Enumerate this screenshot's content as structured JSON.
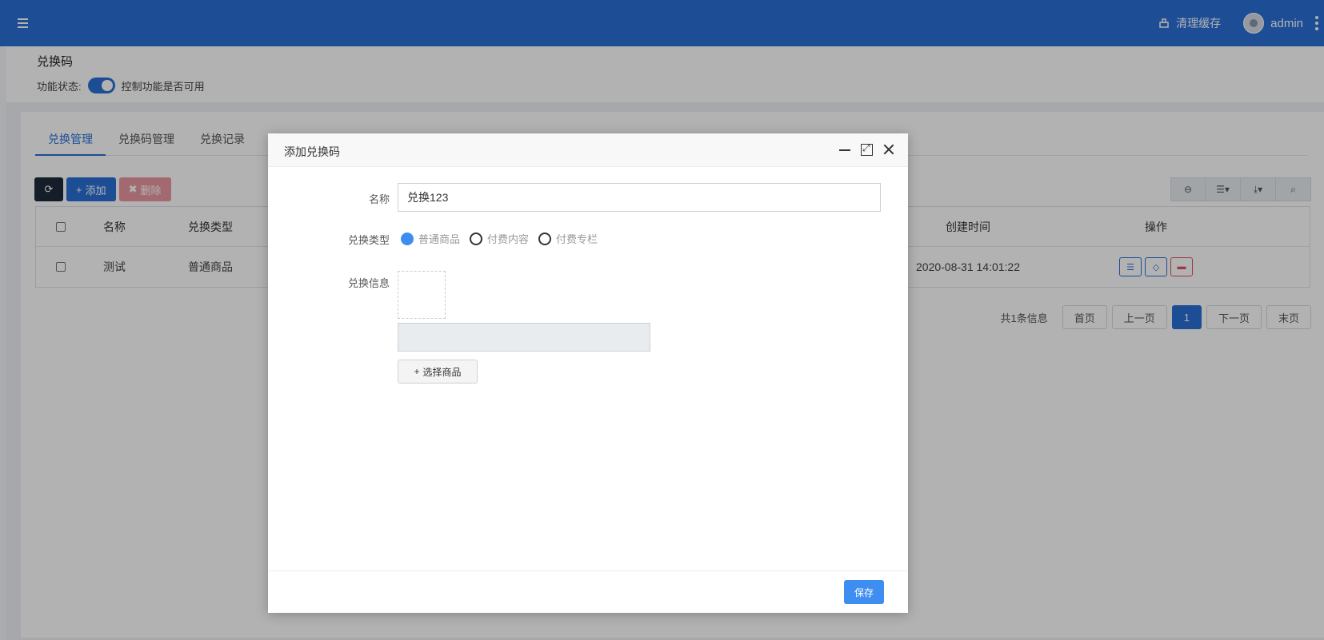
{
  "header": {
    "clear_cache": "清理缓存",
    "user_name": "admin"
  },
  "status_panel": {
    "title": "兑换码",
    "status_label": "功能状态:",
    "status_desc": "控制功能是否可用"
  },
  "tabs": [
    {
      "label": "兑换管理",
      "active": true
    },
    {
      "label": "兑换码管理",
      "active": false
    },
    {
      "label": "兑换记录",
      "active": false
    }
  ],
  "toolbar": {
    "add": "添加",
    "delete": "删除"
  },
  "table": {
    "columns": [
      "名称",
      "兑换类型",
      "创建时间",
      "操作"
    ],
    "rows": [
      {
        "name": "测试",
        "type": "普通商品",
        "created": "2020-08-31 14:01:22"
      }
    ]
  },
  "pagination": {
    "info": "共1条信息",
    "first": "首页",
    "prev": "上一页",
    "current": "1",
    "next": "下一页",
    "last": "末页"
  },
  "modal": {
    "title": "添加兑换码",
    "fields": {
      "name_label": "名称",
      "name_value": "兑换123",
      "type_label": "兑换类型",
      "type_options": [
        "普通商品",
        "付费内容",
        "付费专栏"
      ],
      "type_selected": "普通商品",
      "info_label": "兑换信息",
      "choose_button": "选择商品"
    },
    "save": "保存"
  },
  "colors": {
    "primary": "#2a6fd6",
    "save": "#3d8ef0"
  }
}
